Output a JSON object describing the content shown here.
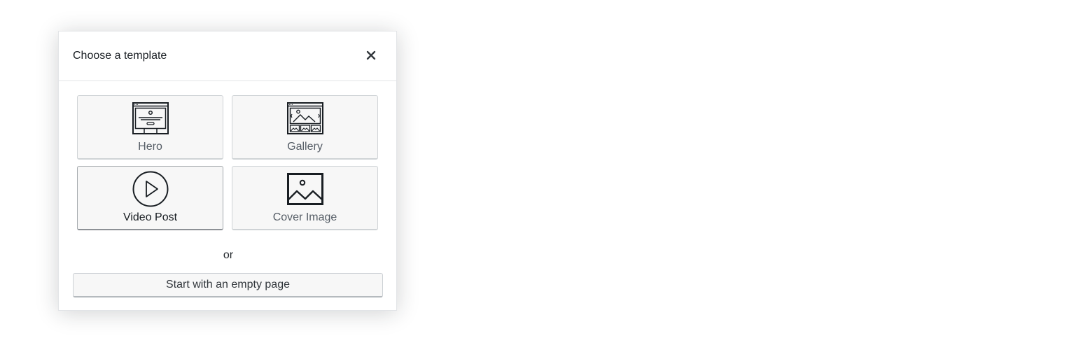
{
  "modal": {
    "title": "Choose a template",
    "close_icon": "close-icon"
  },
  "templates": [
    {
      "label": "Hero",
      "icon": "hero-layout-icon",
      "selected": false
    },
    {
      "label": "Gallery",
      "icon": "gallery-layout-icon",
      "selected": false
    },
    {
      "label": "Video Post",
      "icon": "play-circle-icon",
      "selected": true
    },
    {
      "label": "Cover Image",
      "icon": "image-icon",
      "selected": false
    }
  ],
  "divider_text": "or",
  "empty_page_button": "Start with an empty page",
  "colors": {
    "text_dark": "#191e23",
    "text_muted": "#555d66",
    "border": "#cfd3d6",
    "button_bg": "#f7f7f7"
  }
}
